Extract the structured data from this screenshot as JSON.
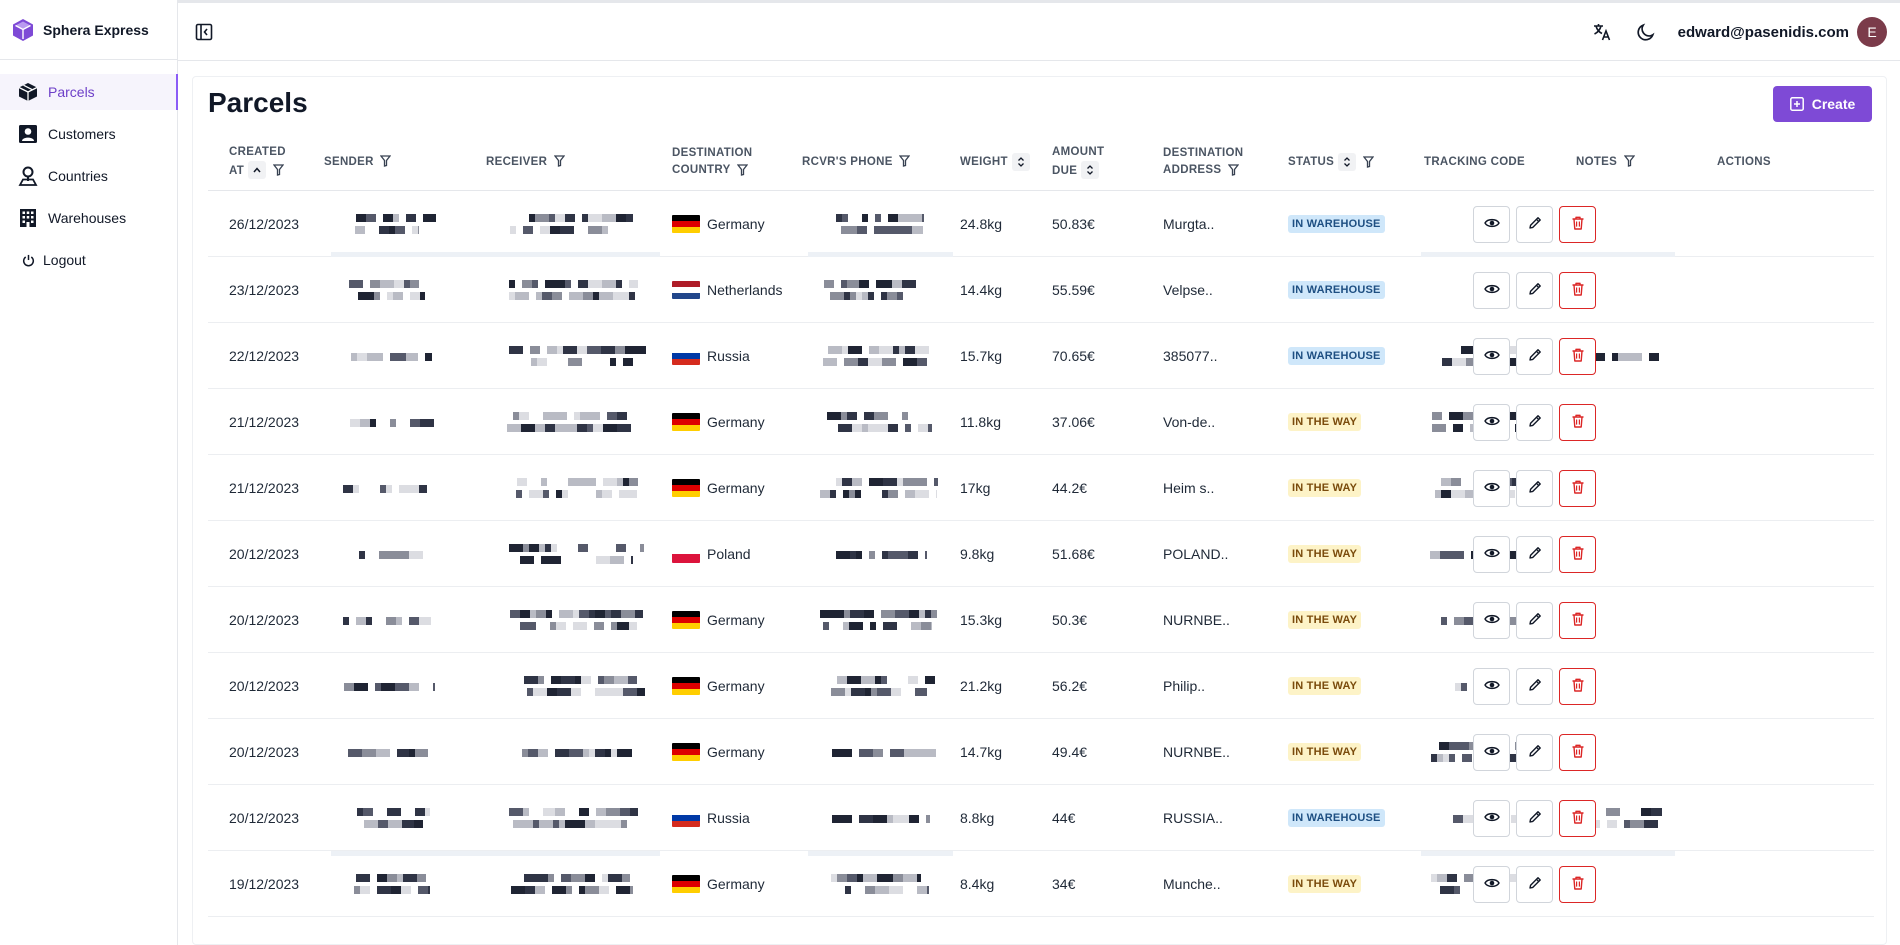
{
  "brand": {
    "name": "Sphera Express",
    "accent": "#7e4ad6"
  },
  "sidebar": {
    "items": [
      {
        "label": "Parcels",
        "icon": "box-icon",
        "active": true
      },
      {
        "label": "Customers",
        "icon": "person-icon",
        "active": false
      },
      {
        "label": "Countries",
        "icon": "map-pin-icon",
        "active": false
      },
      {
        "label": "Warehouses",
        "icon": "building-icon",
        "active": false
      },
      {
        "label": "Logout",
        "icon": "power-icon",
        "active": false
      }
    ]
  },
  "header": {
    "user_email": "edward@pasenidis.com",
    "avatar_initial": "E"
  },
  "page": {
    "title": "Parcels",
    "create_label": "Create"
  },
  "table": {
    "columns": [
      {
        "line1": "CREATED",
        "line2": "AT",
        "sort": true,
        "filter": true
      },
      {
        "line1": "SENDER",
        "line2": "",
        "sort": false,
        "filter": true
      },
      {
        "line1": "RECEIVER",
        "line2": "",
        "sort": false,
        "filter": true
      },
      {
        "line1": "DESTINATION",
        "line2": "COUNTRY",
        "sort": false,
        "filter": true
      },
      {
        "line1": "RCVR'S PHONE",
        "line2": "",
        "sort": false,
        "filter": true
      },
      {
        "line1": "WEIGHT",
        "line2": "",
        "sort": true,
        "filter": false
      },
      {
        "line1": "AMOUNT",
        "line2": "DUE",
        "sort": true,
        "filter": false
      },
      {
        "line1": "DESTINATION",
        "line2": "ADDRESS",
        "sort": false,
        "filter": true
      },
      {
        "line1": "STATUS",
        "line2": "",
        "sort": true,
        "filter": true
      },
      {
        "line1": "TRACKING CODE",
        "line2": "",
        "sort": false,
        "filter": false
      },
      {
        "line1": "NOTES",
        "line2": "",
        "sort": false,
        "filter": true
      },
      {
        "line1": "ACTIONS",
        "line2": "",
        "sort": false,
        "filter": false
      }
    ],
    "rows": [
      {
        "created": "26/12/2023",
        "country": "Germany",
        "weight": "24.8kg",
        "amount": "50.83€",
        "address": "Murgta..",
        "status": "IN WAREHOUSE"
      },
      {
        "created": "23/12/2023",
        "country": "Netherlands",
        "weight": "14.4kg",
        "amount": "55.59€",
        "address": "Velpse..",
        "status": "IN WAREHOUSE"
      },
      {
        "created": "22/12/2023",
        "country": "Russia",
        "weight": "15.7kg",
        "amount": "70.65€",
        "address": "385077..",
        "status": "IN WAREHOUSE"
      },
      {
        "created": "21/12/2023",
        "country": "Germany",
        "weight": "11.8kg",
        "amount": "37.06€",
        "address": "Von-de..",
        "status": "IN THE WAY"
      },
      {
        "created": "21/12/2023",
        "country": "Germany",
        "weight": "17kg",
        "amount": "44.2€",
        "address": "Heim s..",
        "status": "IN THE WAY"
      },
      {
        "created": "20/12/2023",
        "country": "Poland",
        "weight": "9.8kg",
        "amount": "51.68€",
        "address": "POLAND..",
        "status": "IN THE WAY"
      },
      {
        "created": "20/12/2023",
        "country": "Germany",
        "weight": "15.3kg",
        "amount": "50.3€",
        "address": "NURNBE..",
        "status": "IN THE WAY"
      },
      {
        "created": "20/12/2023",
        "country": "Germany",
        "weight": "21.2kg",
        "amount": "56.2€",
        "address": "Philip..",
        "status": "IN THE WAY"
      },
      {
        "created": "20/12/2023",
        "country": "Germany",
        "weight": "14.7kg",
        "amount": "49.4€",
        "address": "NURNBE..",
        "status": "IN THE WAY"
      },
      {
        "created": "20/12/2023",
        "country": "Russia",
        "weight": "8.8kg",
        "amount": "44€",
        "address": "RUSSIA..",
        "status": "IN WAREHOUSE"
      },
      {
        "created": "19/12/2023",
        "country": "Germany",
        "weight": "8.4kg",
        "amount": "34€",
        "address": "Munche..",
        "status": "IN THE WAY"
      }
    ]
  },
  "colors": {
    "in_warehouse_bg": "#cfe7fa",
    "in_the_way_bg": "#fdf3c7",
    "delete": "#dc2626",
    "avatar": "#7b3b4a"
  }
}
